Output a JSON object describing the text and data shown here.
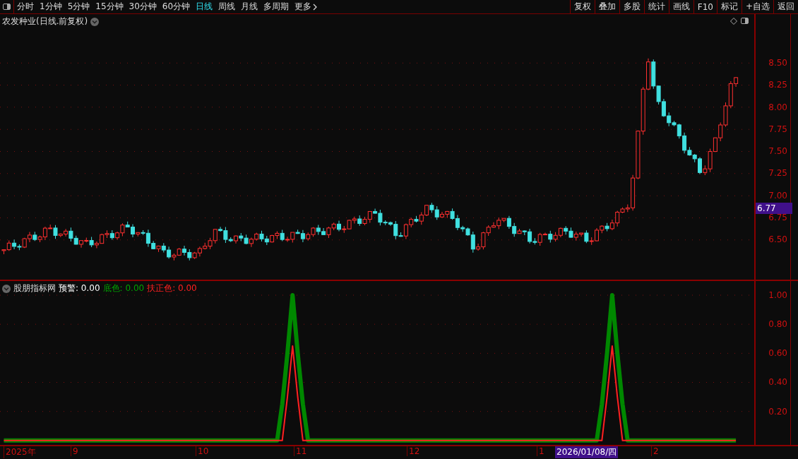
{
  "toolbar": {
    "periods": [
      {
        "label": "分时",
        "selected": false
      },
      {
        "label": "1分钟",
        "selected": false
      },
      {
        "label": "5分钟",
        "selected": false
      },
      {
        "label": "15分钟",
        "selected": false
      },
      {
        "label": "30分钟",
        "selected": false
      },
      {
        "label": "60分钟",
        "selected": false
      },
      {
        "label": "日线",
        "selected": true
      },
      {
        "label": "周线",
        "selected": false
      },
      {
        "label": "月线",
        "selected": false
      },
      {
        "label": "多周期",
        "selected": false
      },
      {
        "label": "更多",
        "selected": false
      }
    ],
    "actions": [
      "复权",
      "叠加",
      "多股",
      "统计",
      "画线",
      "F10",
      "标记",
      "+自选",
      "返回"
    ]
  },
  "chart": {
    "title": "农发种业(日线.前复权)",
    "price_ticks": [
      "8.50",
      "8.25",
      "8.00",
      "7.75",
      "7.50",
      "7.25",
      "7.00",
      "6.75",
      "6.50"
    ],
    "current_price": "6.77"
  },
  "indicator": {
    "name": "股朋指标网",
    "alert": "预警: 0.00",
    "series_readouts": [
      ": 0.00",
      ": 0.00"
    ],
    "chart_data": {
      "type": "line",
      "categories": [
        null,
        null,
        null,
        null,
        null,
        null,
        null,
        null,
        null,
        null,
        null,
        null,
        null,
        null,
        null,
        null,
        null,
        null,
        null,
        null,
        null,
        null,
        null,
        null,
        null,
        null,
        null,
        null,
        null,
        null,
        null,
        null,
        null,
        null,
        null,
        null,
        null,
        null,
        null,
        null,
        null,
        null,
        null,
        null,
        null,
        null,
        null,
        null,
        null,
        null,
        null,
        null,
        null,
        null,
        null,
        null,
        null,
        null,
        null,
        null,
        null,
        null,
        null,
        null,
        null,
        null,
        null,
        null,
        null,
        null,
        null,
        null,
        null,
        null,
        null,
        null,
        null,
        null,
        null,
        null,
        null,
        null,
        null,
        null,
        null,
        null,
        null,
        null,
        null,
        null,
        null,
        null,
        null,
        null,
        null,
        null,
        null,
        null,
        null,
        null,
        null,
        null,
        null,
        null,
        null,
        null,
        null,
        null,
        null,
        null,
        null,
        null,
        null,
        null,
        null,
        null,
        null,
        null,
        null,
        null,
        null,
        null,
        null,
        null,
        null,
        null,
        null,
        null,
        null,
        null,
        null,
        null,
        null,
        null,
        null,
        null,
        null,
        null,
        null,
        null,
        null,
        null,
        null
      ],
      "ylim": [
        -0.03,
        1
      ],
      "grid": true,
      "yticks": [
        {
          "value": 1,
          "label": "1.00"
        },
        {
          "value": 0.8,
          "label": "0.80"
        },
        {
          "value": 0.6,
          "label": "0.60"
        },
        {
          "value": 0.4,
          "label": "0.40"
        },
        {
          "value": 0.2,
          "label": "0.20"
        }
      ],
      "series": [
        {
          "name": "底色",
          "color": "#008800",
          "values": [
            0,
            0,
            0,
            0,
            0,
            0,
            0,
            0,
            0,
            0,
            0,
            0,
            0,
            0,
            0,
            0,
            0,
            0,
            0,
            0,
            0,
            0,
            0,
            0,
            0,
            0,
            0,
            0,
            0,
            0,
            0,
            0,
            0,
            0,
            0,
            0,
            0,
            0,
            0,
            0,
            0,
            0,
            0,
            0,
            0,
            0,
            0,
            0,
            0,
            0,
            0,
            0,
            0,
            0,
            0.25,
            0.6,
            1,
            0.6,
            0.25,
            0,
            0,
            0,
            0,
            0,
            0,
            0,
            0,
            0,
            0,
            0,
            0,
            0,
            0,
            0,
            0,
            0,
            0,
            0,
            0,
            0,
            0,
            0,
            0,
            0,
            0,
            0,
            0,
            0,
            0,
            0,
            0,
            0,
            0,
            0,
            0,
            0,
            0,
            0,
            0,
            0,
            0,
            0,
            0,
            0,
            0,
            0,
            0,
            0,
            0,
            0,
            0,
            0,
            0,
            0,
            0,
            0,
            0.25,
            0.6,
            1,
            0.6,
            0.25,
            0,
            0,
            0,
            0,
            0,
            0,
            0,
            0,
            0,
            0,
            0,
            0,
            0,
            0,
            0,
            0,
            0,
            0,
            0,
            0,
            0,
            0
          ]
        },
        {
          "name": "扶正色",
          "color": "#ff2020",
          "values": [
            0,
            0,
            0,
            0,
            0,
            0,
            0,
            0,
            0,
            0,
            0,
            0,
            0,
            0,
            0,
            0,
            0,
            0,
            0,
            0,
            0,
            0,
            0,
            0,
            0,
            0,
            0,
            0,
            0,
            0,
            0,
            0,
            0,
            0,
            0,
            0,
            0,
            0,
            0,
            0,
            0,
            0,
            0,
            0,
            0,
            0,
            0,
            0,
            0,
            0,
            0,
            0,
            0,
            0,
            0,
            0.3,
            0.65,
            0.3,
            0,
            0,
            0,
            0,
            0,
            0,
            0,
            0,
            0,
            0,
            0,
            0,
            0,
            0,
            0,
            0,
            0,
            0,
            0,
            0,
            0,
            0,
            0,
            0,
            0,
            0,
            0,
            0,
            0,
            0,
            0,
            0,
            0,
            0,
            0,
            0,
            0,
            0,
            0,
            0,
            0,
            0,
            0,
            0,
            0,
            0,
            0,
            0,
            0,
            0,
            0,
            0,
            0,
            0,
            0,
            0,
            0,
            0,
            0,
            0.3,
            0.65,
            0.3,
            0,
            0,
            0,
            0,
            0,
            0,
            0,
            0,
            0,
            0,
            0,
            0,
            0,
            0,
            0,
            0,
            0,
            0,
            0,
            0,
            0,
            0,
            0
          ]
        }
      ]
    }
  },
  "time_axis": {
    "labels": [
      "2025年",
      "9",
      "10",
      "11",
      "12",
      "1",
      "2"
    ],
    "cursor_date": "2026/01/08/四"
  }
}
